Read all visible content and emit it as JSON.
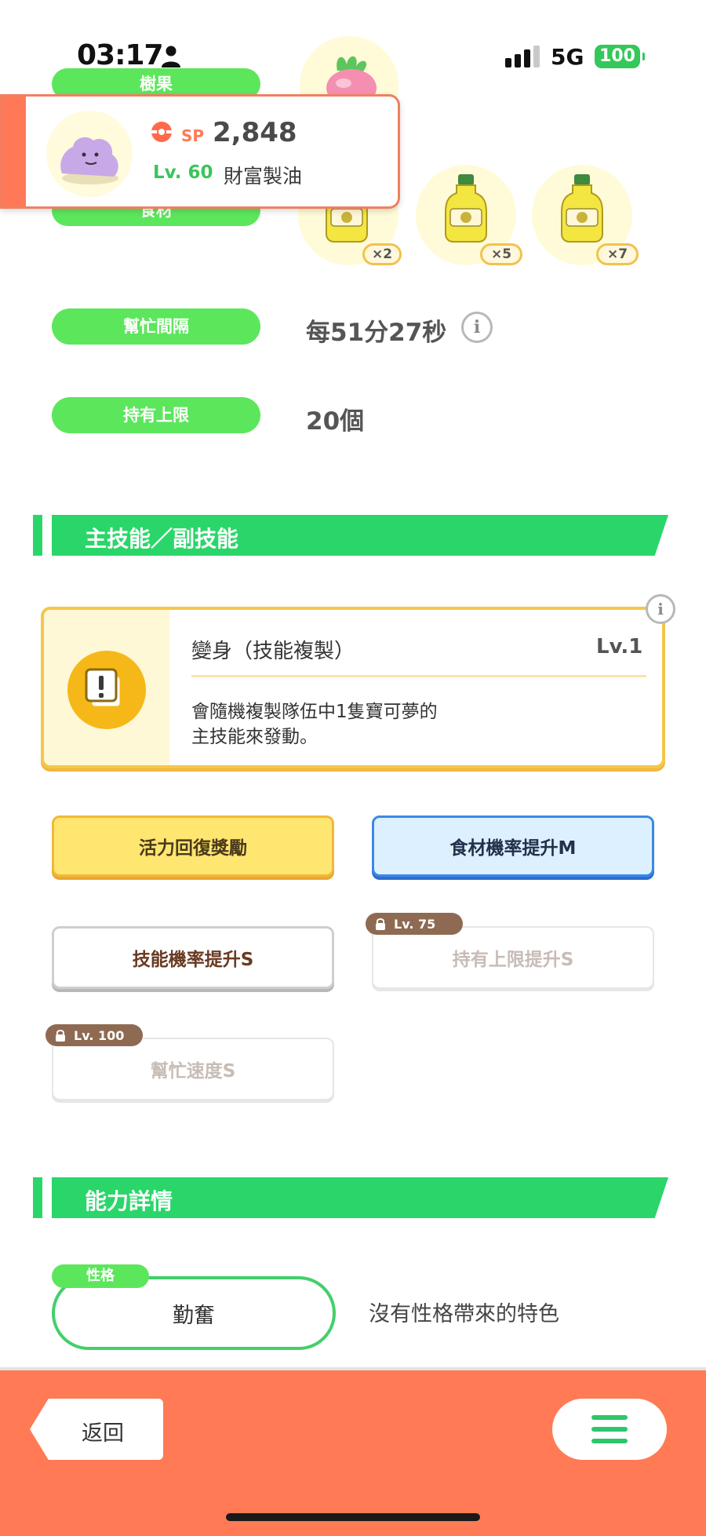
{
  "status_bar": {
    "time": "03:17",
    "network": "5G",
    "battery": "100"
  },
  "berries": {
    "label": "樹果"
  },
  "pokemon": {
    "sp_label": "SP",
    "sp_value": "2,848",
    "level": "Lv. 60",
    "nickname": "財富製油"
  },
  "ingredients": {
    "label": "食材",
    "items": [
      {
        "name": "oil-bottle-icon",
        "qty": "×2"
      },
      {
        "name": "oil-bottle-icon",
        "qty": "×5"
      },
      {
        "name": "oil-bottle-icon",
        "qty": "×7"
      }
    ]
  },
  "help_interval": {
    "label": "幫忙間隔",
    "value": "每51分27秒"
  },
  "carry_limit": {
    "label": "持有上限",
    "value": "20個"
  },
  "skills_section": {
    "title": "主技能／副技能"
  },
  "main_skill": {
    "name": "變身（技能複製）",
    "level": "Lv.1",
    "description_line1": "會隨機複製隊伍中1隻寶可夢的",
    "description_line2": "主技能來發動。"
  },
  "sub_skills": [
    {
      "label": "活力回復獎勵",
      "style": "gold"
    },
    {
      "label": "食材機率提升M",
      "style": "blue"
    },
    {
      "label": "技能機率提升S",
      "style": "white"
    },
    {
      "label": "持有上限提升S",
      "style": "locked",
      "unlock": "Lv. 75"
    },
    {
      "label": "幫忙速度S",
      "style": "locked",
      "unlock": "Lv. 100"
    }
  ],
  "stats_section": {
    "title": "能力詳情"
  },
  "nature": {
    "tag": "性格",
    "value": "勤奮",
    "effect": "沒有性格帶來的特色"
  },
  "bottom_bar": {
    "back_label": "返回"
  },
  "colors": {
    "accent_green": "#2ad66a",
    "pill_green": "#5ce65c",
    "bottom_orange": "#ff7a55",
    "skill_gold": "#f6c64a",
    "sub_blue": "#3c88e6",
    "lock_brown": "#8f6a52"
  }
}
